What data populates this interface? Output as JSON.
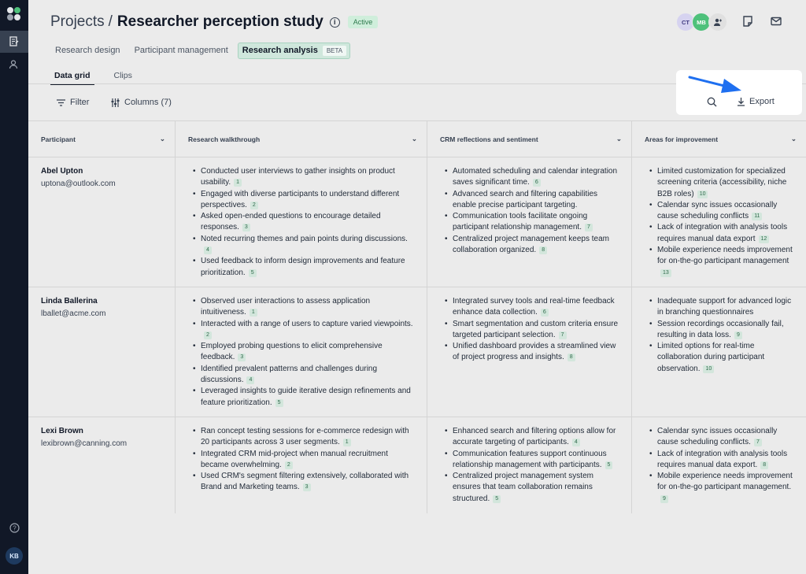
{
  "sidebar": {
    "user_initials": "KB"
  },
  "header": {
    "breadcrumb": "Projects",
    "separator": "/",
    "project_name": "Researcher perception study",
    "status": "Active",
    "avatars": [
      "CT",
      "MB"
    ]
  },
  "tabs": [
    {
      "label": "Research design"
    },
    {
      "label": "Participant management"
    },
    {
      "label": "Research analysis",
      "badge": "BETA"
    }
  ],
  "subtabs": [
    {
      "label": "Data grid"
    },
    {
      "label": "Clips"
    }
  ],
  "toolbar": {
    "filter_label": "Filter",
    "columns_label": "Columns (7)",
    "export_label": "Export"
  },
  "grid": {
    "columns": [
      "Participant",
      "Research walkthrough",
      "CRM reflections and sentiment",
      "Areas for improvement"
    ],
    "rows": [
      {
        "name": "Abel Upton",
        "email": "uptona@outlook.com",
        "walkthrough": [
          {
            "text": "Conducted user interviews to gather insights on product usability.",
            "cite": "1"
          },
          {
            "text": "Engaged with diverse participants to understand different perspectives.",
            "cite": "2"
          },
          {
            "text": "Asked open-ended questions to encourage detailed responses.",
            "cite": "3"
          },
          {
            "text": "Noted recurring themes and pain points during discussions.",
            "cite": "4"
          },
          {
            "text": "Used feedback to inform design improvements and feature prioritization.",
            "cite": "5"
          }
        ],
        "crm": [
          {
            "text": "Automated scheduling and calendar integration saves significant time.",
            "cite": "6"
          },
          {
            "text": "Advanced search and filtering capabilities enable precise participant targeting.",
            "cite": ""
          },
          {
            "text": "Communication tools facilitate ongoing participant relationship management.",
            "cite": "7"
          },
          {
            "text": "Centralized project management keeps team collaboration organized.",
            "cite": "8"
          }
        ],
        "improve": [
          {
            "text": "Limited customization for specialized screening criteria (accessibility, niche B2B roles)",
            "cite": "10"
          },
          {
            "text": "Calendar sync issues occasionally cause scheduling conflicts",
            "cite": "11"
          },
          {
            "text": "Lack of integration with analysis tools requires manual data export",
            "cite": "12"
          },
          {
            "text": "Mobile experience needs improvement for on-the-go participant management",
            "cite": "13"
          }
        ]
      },
      {
        "name": "Linda Ballerina",
        "email": "lballet@acme.com",
        "walkthrough": [
          {
            "text": "Observed user interactions to assess application intuitiveness.",
            "cite": "1"
          },
          {
            "text": "Interacted with a range of users to capture varied viewpoints.",
            "cite": "2"
          },
          {
            "text": "Employed probing questions to elicit comprehensive feedback.",
            "cite": "3"
          },
          {
            "text": "Identified prevalent patterns and challenges during discussions.",
            "cite": "4"
          },
          {
            "text": "Leveraged insights to guide iterative design refinements and feature prioritization.",
            "cite": "5"
          }
        ],
        "crm": [
          {
            "text": "Integrated survey tools and real-time feedback enhance data collection.",
            "cite": "6"
          },
          {
            "text": "Smart segmentation and custom criteria ensure targeted participant selection.",
            "cite": "7"
          },
          {
            "text": "Unified dashboard provides a streamlined view of project progress and insights.",
            "cite": "8"
          }
        ],
        "improve": [
          {
            "text": "Inadequate support for advanced logic in branching questionnaires",
            "cite": ""
          },
          {
            "text": "Session recordings occasionally fail, resulting in data loss.",
            "cite": "9"
          },
          {
            "text": "Limited options for real-time collaboration during participant observation.",
            "cite": "10"
          }
        ]
      },
      {
        "name": "Lexi Brown",
        "email": "lexibrown@canning.com",
        "walkthrough": [
          {
            "text": "Ran concept testing sessions for e-commerce redesign with 20 participants across 3 user segments.",
            "cite": "1"
          },
          {
            "text": "Integrated CRM mid-project when manual recruitment became overwhelming.",
            "cite": "2"
          },
          {
            "text": "Used CRM's segment filtering extensively, collaborated with Brand and Marketing teams.",
            "cite": "3"
          }
        ],
        "crm": [
          {
            "text": " Enhanced search and filtering options allow for accurate targeting of participants.",
            "cite": "4"
          },
          {
            "text": "Communication features support continuous relationship management with participants.",
            "cite": "5"
          },
          {
            "text": "Centralized project management system ensures that team collaboration remains structured.",
            "cite": "5"
          }
        ],
        "improve": [
          {
            "text": "Calendar sync issues occasionally cause scheduling conflicts.",
            "cite": "7"
          },
          {
            "text": "Lack of integration with analysis tools requires manual data export.",
            "cite": "8"
          },
          {
            "text": "Mobile experience needs improvement for on-the-go participant management.",
            "cite": "9"
          }
        ]
      }
    ]
  }
}
